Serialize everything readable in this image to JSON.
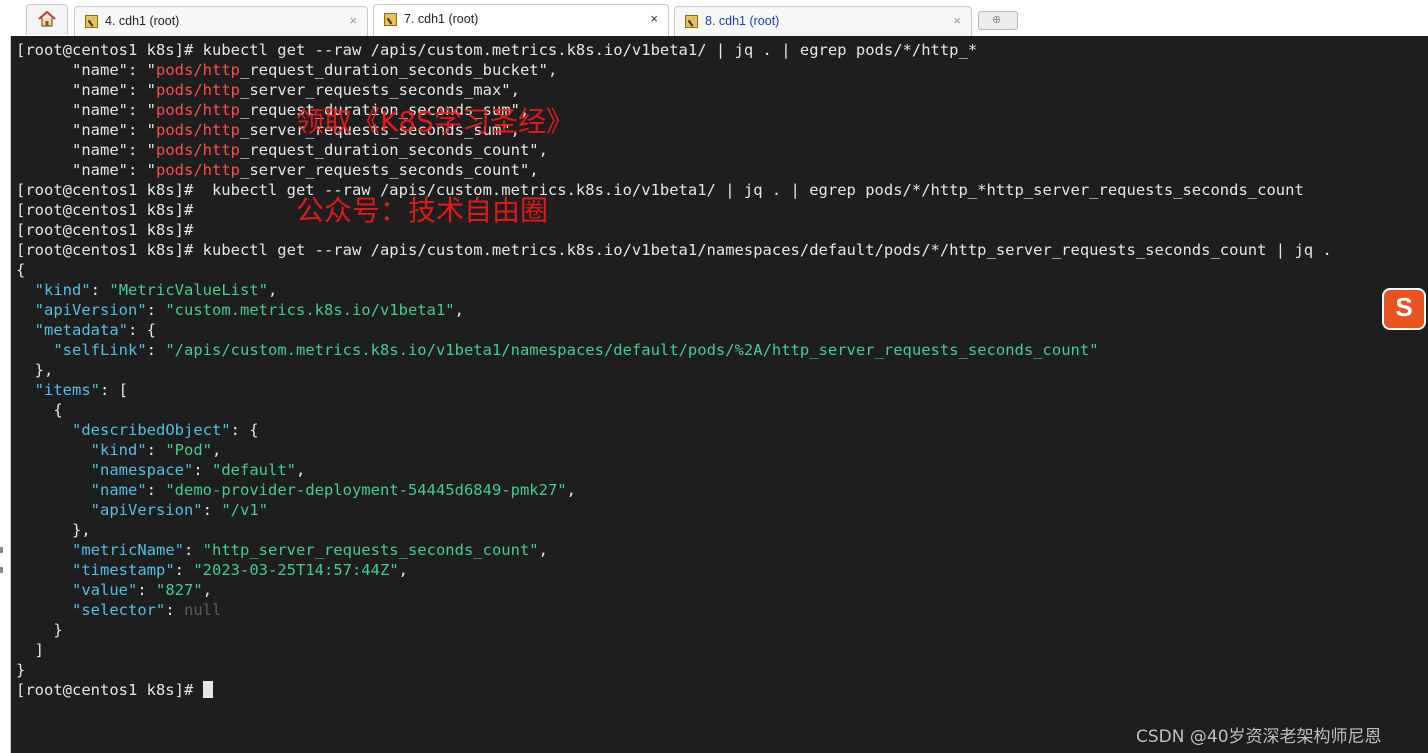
{
  "tabs": [
    {
      "label": "4. cdh1 (root)",
      "close": "×"
    },
    {
      "label": "7. cdh1 (root)",
      "close": "×"
    },
    {
      "label": "8. cdh1 (root)",
      "close": "×"
    }
  ],
  "new_tab_glyph": "⊕",
  "terminal": {
    "prompt": "[root@centos1 k8s]# ",
    "cmd1": "kubectl get --raw /apis/custom.metrics.k8s.io/v1beta1/ | jq . | egrep pods/*/http_*",
    "name_key": "\"name\"",
    "grep_match": "pods/http",
    "metric_suffixes": [
      "_request_duration_seconds_bucket",
      "_server_requests_seconds_max",
      "_request_duration_seconds_sum",
      "_server_requests_seconds_sum",
      "_request_duration_seconds_count",
      "_server_requests_seconds_count"
    ],
    "cmd2": " kubectl get --raw /apis/custom.metrics.k8s.io/v1beta1/ | jq . | egrep pods/*/http_*http_server_requests_seconds_count",
    "cmd3": "kubectl get --raw /apis/custom.metrics.k8s.io/v1beta1/namespaces/default/pods/*/http_server_requests_seconds_count | jq .",
    "json": {
      "kind": "MetricValueList",
      "apiVersion": "custom.metrics.k8s.io/v1beta1",
      "selfLink": "/apis/custom.metrics.k8s.io/v1beta1/namespaces/default/pods/%2A/http_server_requests_seconds_count",
      "obj_kind": "Pod",
      "namespace": "default",
      "pod_name": "demo-provider-deployment-54445d6849-pmk27",
      "obj_api": "/v1",
      "metricName": "http_server_requests_seconds_count",
      "timestamp": "2023-03-25T14:57:44Z",
      "value": "827",
      "selector": "null"
    }
  },
  "watermark": {
    "line1": "领取《K8S学习圣经》",
    "line2": "公众号：技术自由圈"
  },
  "sogou_label": "S",
  "csdn_credit": "CSDN @40岁资深老架构师尼恩",
  "colors": {
    "key": "#4ec0e8",
    "string": "#3fcf8e",
    "match": "#ff4d4d",
    "background": "#1e1e1e"
  }
}
